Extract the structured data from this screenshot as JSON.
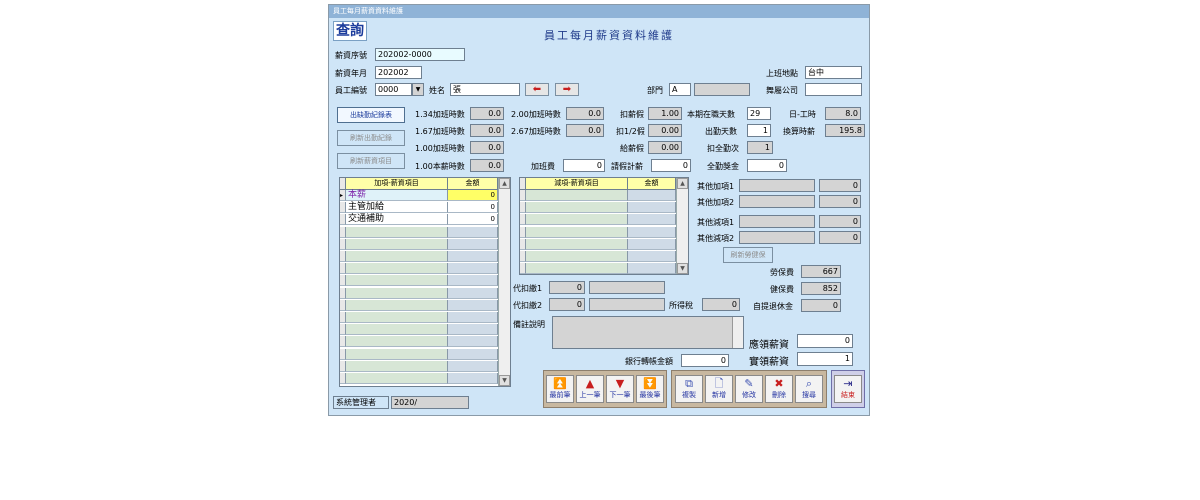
{
  "window": {
    "title": "員工每月薪資資料維護"
  },
  "tab": {
    "label": "查詢"
  },
  "form": {
    "title": "員工每月薪資資料維護"
  },
  "header": {
    "salary_seq_label": "薪資序號",
    "salary_seq": "202002-0000",
    "salary_month_label": "薪資年月",
    "salary_month": "202002",
    "emp_no_label": "員工編號",
    "emp_no": "0000",
    "name_label": "姓名",
    "name": "張",
    "dept_label": "部門",
    "dept": "A",
    "dept_name": "",
    "work_location_label": "上班地點",
    "work_location": "台中",
    "dispatch_company_label": "舞屬公司",
    "dispatch_company": ""
  },
  "side_buttons": {
    "attendance": "出缺勤紀錄表",
    "refresh_attendance": "刷新出勤紀錄",
    "refresh_salary": "刷新薪資項目"
  },
  "stats": {
    "ot134_label": "1.34加班時數",
    "ot134": "0.0",
    "ot167_label": "1.67加班時數",
    "ot167": "0.0",
    "ot100_label": "1.00加班時數",
    "ot100": "0.0",
    "base100_label": "1.00本薪時數",
    "base100": "0.0",
    "ot200_label": "2.00加班時數",
    "ot200": "0.0",
    "ot267_label": "2.67加班時數",
    "ot267": "0.0",
    "overtime_fee_label": "加班費",
    "overtime_fee": "0",
    "deduct_leave_label": "扣薪假",
    "deduct_leave": "1.00",
    "half_leave_label": "扣1/2假",
    "half_leave": "0.00",
    "paid_leave_label": "給薪假",
    "paid_leave": "0.00",
    "leave_count_label": "請假計薪",
    "leave_count": "0",
    "employed_days_label": "本期在職天數",
    "employed_days": "29",
    "attend_days_label": "出勤天數",
    "attend_days": "1",
    "deduct_full_label": "扣全勤次",
    "deduct_full": "1",
    "full_bonus_label": "全勤獎金",
    "full_bonus": "0",
    "daily_hours_label": "日-工時",
    "daily_hours": "8.0",
    "hourly_pay_label": "換算時薪",
    "hourly_pay": "195.8"
  },
  "add_grid": {
    "col1": "加項-薪資項目",
    "col2": "金額",
    "rows": [
      {
        "item": "本薪",
        "amount": "0"
      },
      {
        "item": "主管加給",
        "amount": "0"
      },
      {
        "item": "交通補助",
        "amount": "0"
      }
    ]
  },
  "sub_grid": {
    "col1": "減項-薪資項目",
    "col2": "金額"
  },
  "other": {
    "add1_label": "其他加項1",
    "add1_name": "",
    "add1": "0",
    "add2_label": "其他加項2",
    "add2_name": "",
    "add2": "0",
    "sub1_label": "其他減項1",
    "sub1_name": "",
    "sub1": "0",
    "sub2_label": "其他減項2",
    "sub2_name": "",
    "sub2": "0",
    "refresh_insurance": "刷新勞健保",
    "labor_label": "勞保費",
    "labor": "667",
    "health_label": "健保費",
    "health": "852",
    "pension_label": "自提退休金",
    "pension": "0"
  },
  "withhold": {
    "w1_label": "代扣繳1",
    "w1": "0",
    "w1_name": "",
    "w2_label": "代扣繳2",
    "w2": "0",
    "w2_name": "",
    "tax_label": "所得稅",
    "tax": "0"
  },
  "notes": {
    "label": "備註說明",
    "value": ""
  },
  "totals": {
    "bank_label": "銀行轉帳金額",
    "bank": "0",
    "payable_label": "應領薪資",
    "payable": "0",
    "actual_label": "實領薪資",
    "actual": "1"
  },
  "status": {
    "user": "系統管理者",
    "date": "2020/"
  },
  "nav": {
    "first": "最前筆",
    "prev": "上一筆",
    "next": "下一筆",
    "last": "最後筆"
  },
  "actions": {
    "copy": "複製",
    "new": "新增",
    "edit": "修改",
    "delete": "刪除",
    "search": "搜尋",
    "exit": "結束"
  },
  "colors": {
    "window_bg": "#cfe5f7",
    "titlebar": "#8fb3d7",
    "grid_header": "#ffffa8",
    "selected_amount": "#ffff66"
  }
}
